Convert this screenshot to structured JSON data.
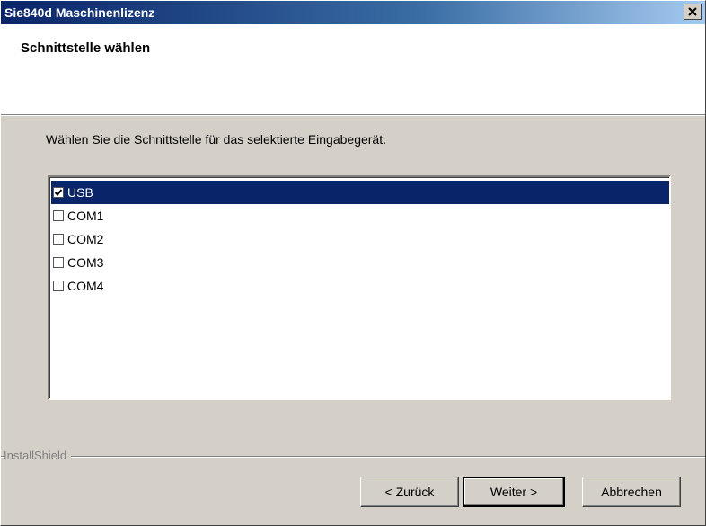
{
  "window": {
    "title": "Sie840d Maschinenlizenz",
    "close_icon": "close-icon"
  },
  "header": {
    "heading": "Schnittstelle wählen"
  },
  "main": {
    "instruction": "Wählen Sie die Schnittstelle für das selektierte Eingabegerät.",
    "interfaces": [
      {
        "label": "USB",
        "checked": true,
        "selected": true
      },
      {
        "label": "COM1",
        "checked": false,
        "selected": false
      },
      {
        "label": "COM2",
        "checked": false,
        "selected": false
      },
      {
        "label": "COM3",
        "checked": false,
        "selected": false
      },
      {
        "label": "COM4",
        "checked": false,
        "selected": false
      }
    ]
  },
  "footer": {
    "branding": "InstallShield",
    "back_label": "< Zurück",
    "next_label": "Weiter >",
    "cancel_label": "Abbrechen"
  },
  "colors": {
    "selection": "#0a246a",
    "title_gradient_start": "#0a246a",
    "title_gradient_end": "#a6caf0",
    "dialog_bg": "#d4d0c8"
  }
}
